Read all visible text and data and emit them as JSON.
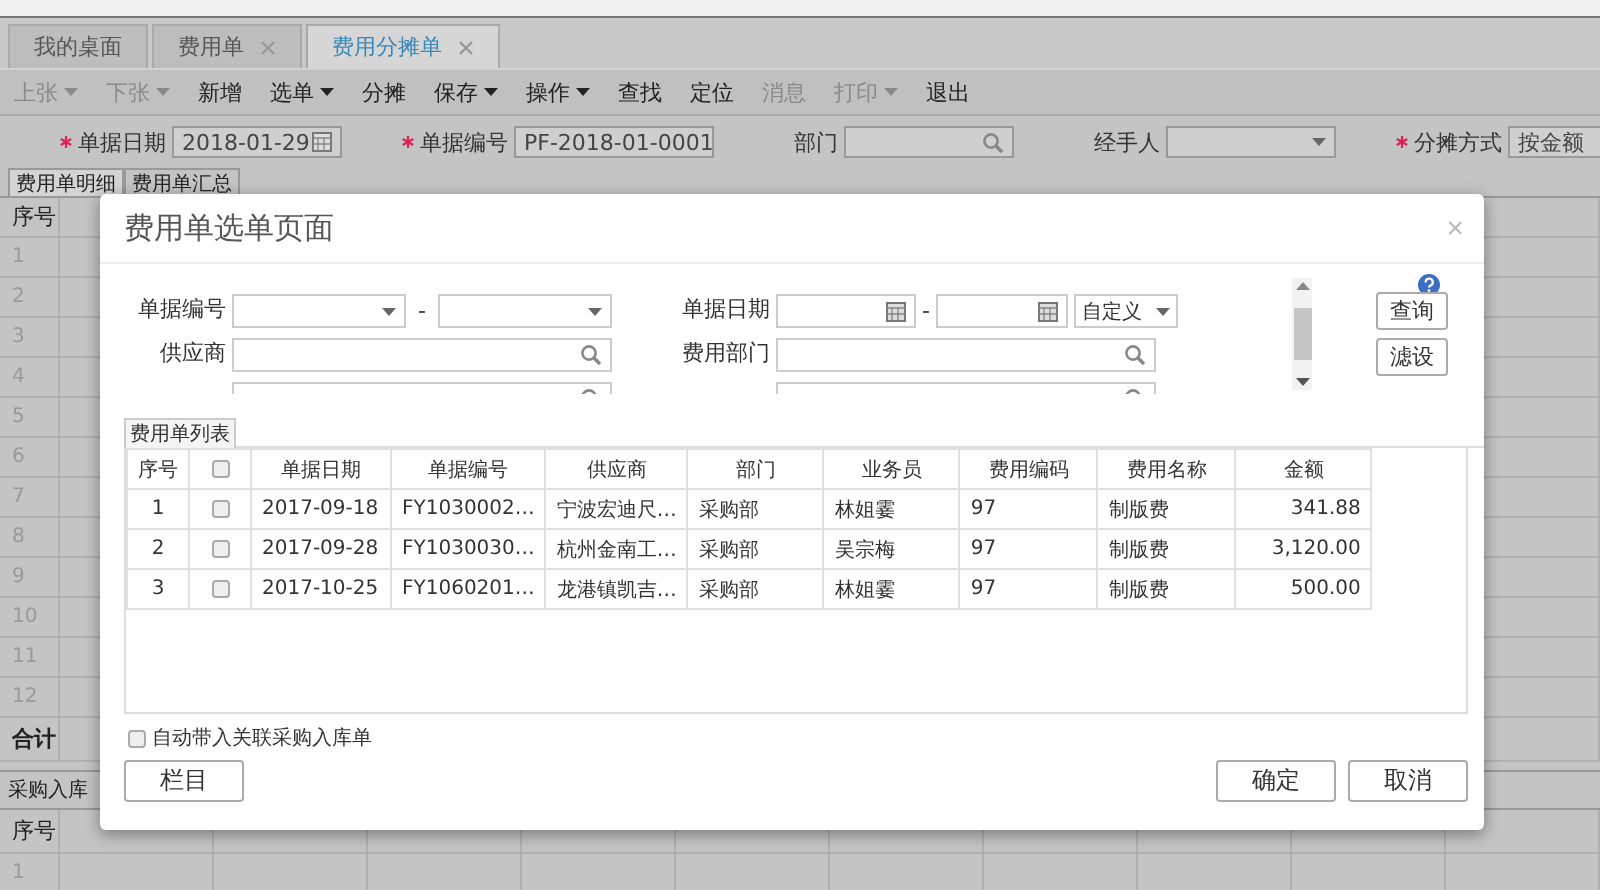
{
  "tabs": [
    {
      "label": "我的桌面",
      "closable": false,
      "selected": false
    },
    {
      "label": "费用单",
      "closable": true,
      "selected": false
    },
    {
      "label": "费用分摊单",
      "closable": true,
      "selected": true
    }
  ],
  "toolbar": [
    {
      "label": "上张",
      "dropdown": true,
      "disabled": true
    },
    {
      "label": "下张",
      "dropdown": true,
      "disabled": true
    },
    {
      "label": "新增",
      "dropdown": false,
      "disabled": false
    },
    {
      "label": "选单",
      "dropdown": true,
      "disabled": false
    },
    {
      "label": "分摊",
      "dropdown": false,
      "disabled": false
    },
    {
      "label": "保存",
      "dropdown": true,
      "disabled": false
    },
    {
      "label": "操作",
      "dropdown": true,
      "disabled": false
    },
    {
      "label": "查找",
      "dropdown": false,
      "disabled": false
    },
    {
      "label": "定位",
      "dropdown": false,
      "disabled": false
    },
    {
      "label": "消息",
      "dropdown": false,
      "disabled": true
    },
    {
      "label": "打印",
      "dropdown": true,
      "disabled": true
    },
    {
      "label": "退出",
      "dropdown": false,
      "disabled": false
    }
  ],
  "header_form": [
    {
      "label": "单据日期",
      "required": true,
      "kind": "date",
      "value": "2018-01-29"
    },
    {
      "label": "单据编号",
      "required": true,
      "kind": "text",
      "value": "PF-2018-01-0001"
    },
    {
      "label": "部门",
      "required": false,
      "kind": "lookup"
    },
    {
      "label": "经手人",
      "required": false,
      "kind": "select"
    },
    {
      "label": "分摊方式",
      "required": true,
      "kind": "text",
      "value": "按金额"
    }
  ],
  "detail_tabs": [
    {
      "label": "费用单明细",
      "selected": true
    },
    {
      "label": "费用单汇总",
      "selected": false
    }
  ],
  "detail_grid": {
    "header": "序号",
    "rows": [
      "1",
      "2",
      "3",
      "4",
      "5",
      "6",
      "7",
      "8",
      "9",
      "10",
      "11",
      "12"
    ],
    "total": "合计"
  },
  "bottom_tab": "采购入库",
  "bottom_grid": {
    "header": "序号",
    "rows": [
      "1"
    ]
  },
  "dialog": {
    "title": "费用单选单页面",
    "close": "×",
    "filters": [
      {
        "label": "单据编号",
        "kind": "select-range",
        "separator": "-"
      },
      {
        "label": "单据日期",
        "kind": "date-range",
        "separator": "-",
        "preset": "自定义"
      },
      {
        "label": "供应商",
        "kind": "lookup"
      },
      {
        "label": "费用部门",
        "kind": "lookup"
      }
    ],
    "side_buttons": [
      "查询",
      "滤设"
    ],
    "list_tab": "费用单列表",
    "columns": [
      "序号",
      "",
      "单据日期",
      "单据编号",
      "供应商",
      "部门",
      "业务员",
      "费用编码",
      "费用名称",
      "金额"
    ],
    "rows": [
      {
        "checked": false,
        "cells": [
          "1",
          "",
          "2017-09-18",
          "FY1030002…",
          "宁波宏迪尺…",
          "采购部",
          "林姐霎",
          "97",
          "制版费",
          "341.88"
        ]
      },
      {
        "checked": false,
        "cells": [
          "2",
          "",
          "2017-09-28",
          "FY1030030…",
          "杭州金南工…",
          "采购部",
          "吴宗梅",
          "97",
          "制版费",
          "3,120.00"
        ]
      },
      {
        "checked": false,
        "cells": [
          "3",
          "",
          "2017-10-25",
          "FY1060201…",
          "龙港镇凯吉…",
          "采购部",
          "林姐霎",
          "97",
          "制版费",
          "500.00"
        ]
      }
    ],
    "header_checked": false,
    "auto_bring": {
      "label": "自动带入关联采购入库单",
      "checked": false
    },
    "columns_button": "栏目",
    "actions": [
      "确定",
      "取消"
    ]
  }
}
